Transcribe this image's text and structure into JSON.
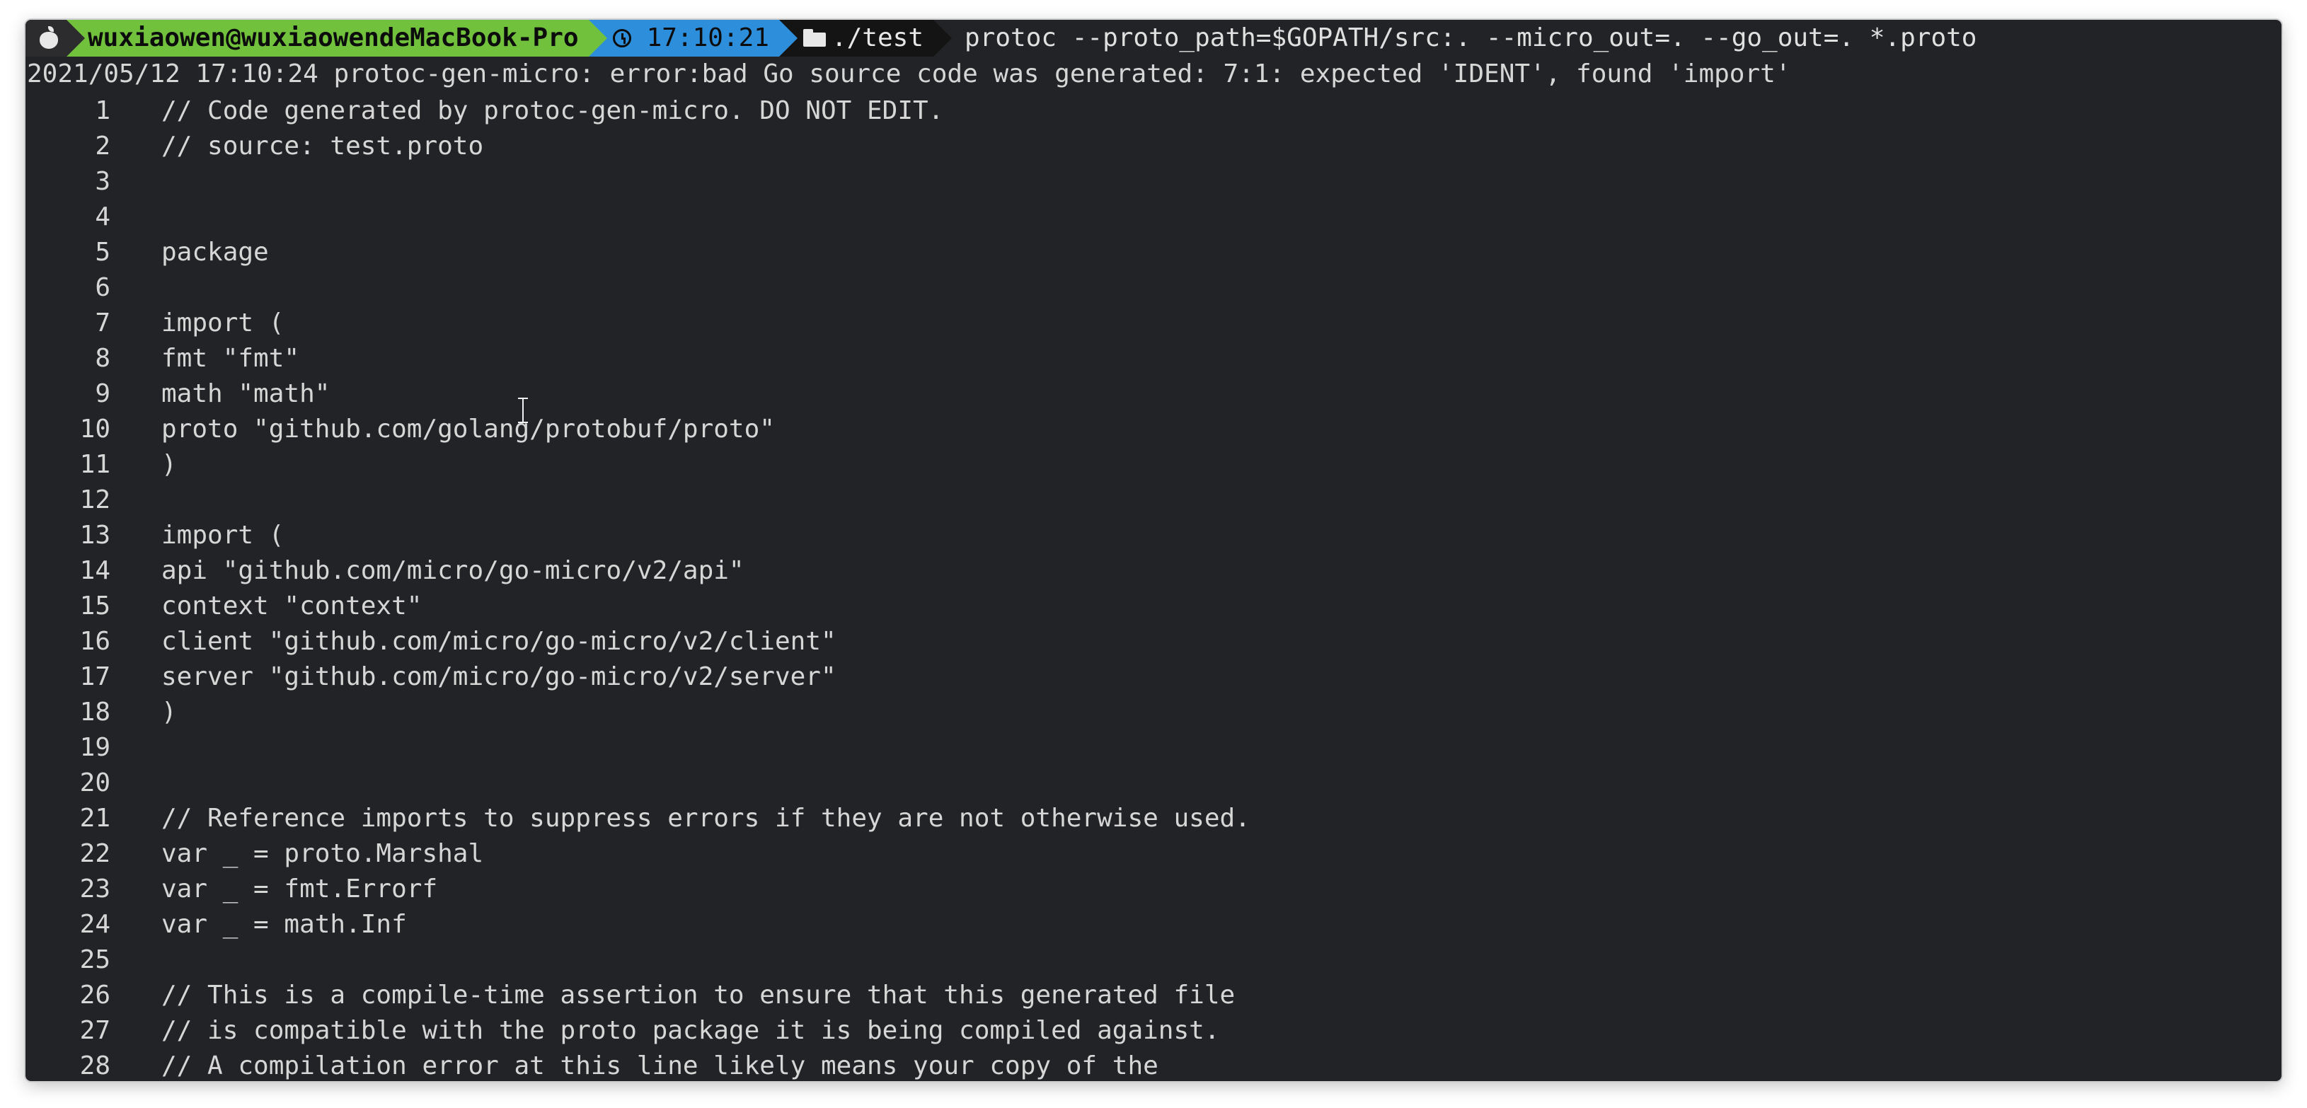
{
  "prompt": {
    "user_host": "wuxiaowen@wuxiaowendeMacBook-Pro",
    "time": "17:10:21",
    "directory": "./test",
    "command": "protoc --proto_path=$GOPATH/src:. --micro_out=. --go_out=. *.proto"
  },
  "error_message": "2021/05/12 17:10:24 protoc-gen-micro: error:bad Go source code was generated: 7:1: expected 'IDENT', found 'import'",
  "code_lines": [
    {
      "n": "1",
      "text": "// Code generated by protoc-gen-micro. DO NOT EDIT."
    },
    {
      "n": "2",
      "text": "// source: test.proto"
    },
    {
      "n": "3",
      "text": ""
    },
    {
      "n": "4",
      "text": ""
    },
    {
      "n": "5",
      "text": "package"
    },
    {
      "n": "6",
      "text": ""
    },
    {
      "n": "7",
      "text": "import ("
    },
    {
      "n": "8",
      "text": "fmt \"fmt\""
    },
    {
      "n": "9",
      "text": "math \"math\""
    },
    {
      "n": "10",
      "text": "proto \"github.com/golang/protobuf/proto\""
    },
    {
      "n": "11",
      "text": ")"
    },
    {
      "n": "12",
      "text": ""
    },
    {
      "n": "13",
      "text": "import ("
    },
    {
      "n": "14",
      "text": "api \"github.com/micro/go-micro/v2/api\""
    },
    {
      "n": "15",
      "text": "context \"context\""
    },
    {
      "n": "16",
      "text": "client \"github.com/micro/go-micro/v2/client\""
    },
    {
      "n": "17",
      "text": "server \"github.com/micro/go-micro/v2/server\""
    },
    {
      "n": "18",
      "text": ")"
    },
    {
      "n": "19",
      "text": ""
    },
    {
      "n": "20",
      "text": ""
    },
    {
      "n": "21",
      "text": "// Reference imports to suppress errors if they are not otherwise used."
    },
    {
      "n": "22",
      "text": "var _ = proto.Marshal"
    },
    {
      "n": "23",
      "text": "var _ = fmt.Errorf"
    },
    {
      "n": "24",
      "text": "var _ = math.Inf"
    },
    {
      "n": "25",
      "text": ""
    },
    {
      "n": "26",
      "text": "// This is a compile-time assertion to ensure that this generated file"
    },
    {
      "n": "27",
      "text": "// is compatible with the proto package it is being compiled against."
    },
    {
      "n": "28",
      "text": "// A compilation error at this line likely means your copy of the"
    }
  ]
}
